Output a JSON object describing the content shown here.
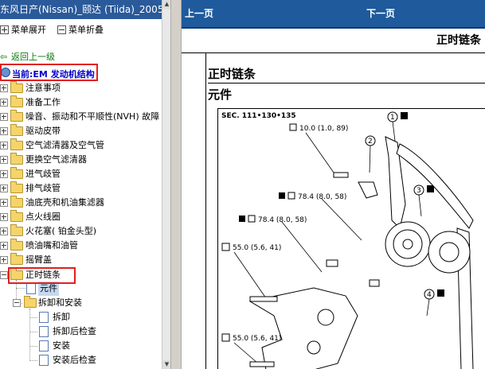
{
  "window": {
    "title": "东风日产(Nissan)_颐达 (Tiida)_2005"
  },
  "toolbar": {
    "expand_label": "菜单展开",
    "collapse_label": "菜单折叠"
  },
  "tree": {
    "back_label": "返回上一级",
    "current_label": "当前:EM 发动机结构",
    "items": [
      "注意事项",
      "准备工作",
      "噪音、振动和不平顺性(NVH) 故障",
      "驱动皮带",
      "空气滤清器及空气管",
      "更换空气滤清器",
      "进气歧管",
      "排气歧管",
      "油底壳和机油集滤器",
      "点火线圈",
      "火花塞( 铂金头型)",
      "喷油嘴和油管",
      "摇臂盖",
      "正时链条"
    ],
    "sub": {
      "parts": "元件",
      "disassembly": "拆卸和安装",
      "children": [
        "拆卸",
        "拆卸后检查",
        "安装",
        "安装后检查"
      ]
    }
  },
  "nav": {
    "prev_label": "上一页",
    "next_label": "下一页"
  },
  "document": {
    "page_header": "正时链条",
    "section_title": "正时链条",
    "section_subtitle": "元件",
    "figure": {
      "code": "SEC. 111•130•135",
      "callouts": [
        "1",
        "2",
        "3",
        "4"
      ],
      "torques": [
        "10.0 (1.0, 89)",
        "78.4 (8.0, 58)",
        "78.4 (8.0, 58)",
        "55.0 (5.6, 41)",
        "55.0 (5.6, 41)"
      ]
    }
  },
  "colors": {
    "nav_blue": "#1e5a9c",
    "highlight_red": "#e02020",
    "link_blue": "#0000cc",
    "back_green": "#0a7a0a"
  }
}
